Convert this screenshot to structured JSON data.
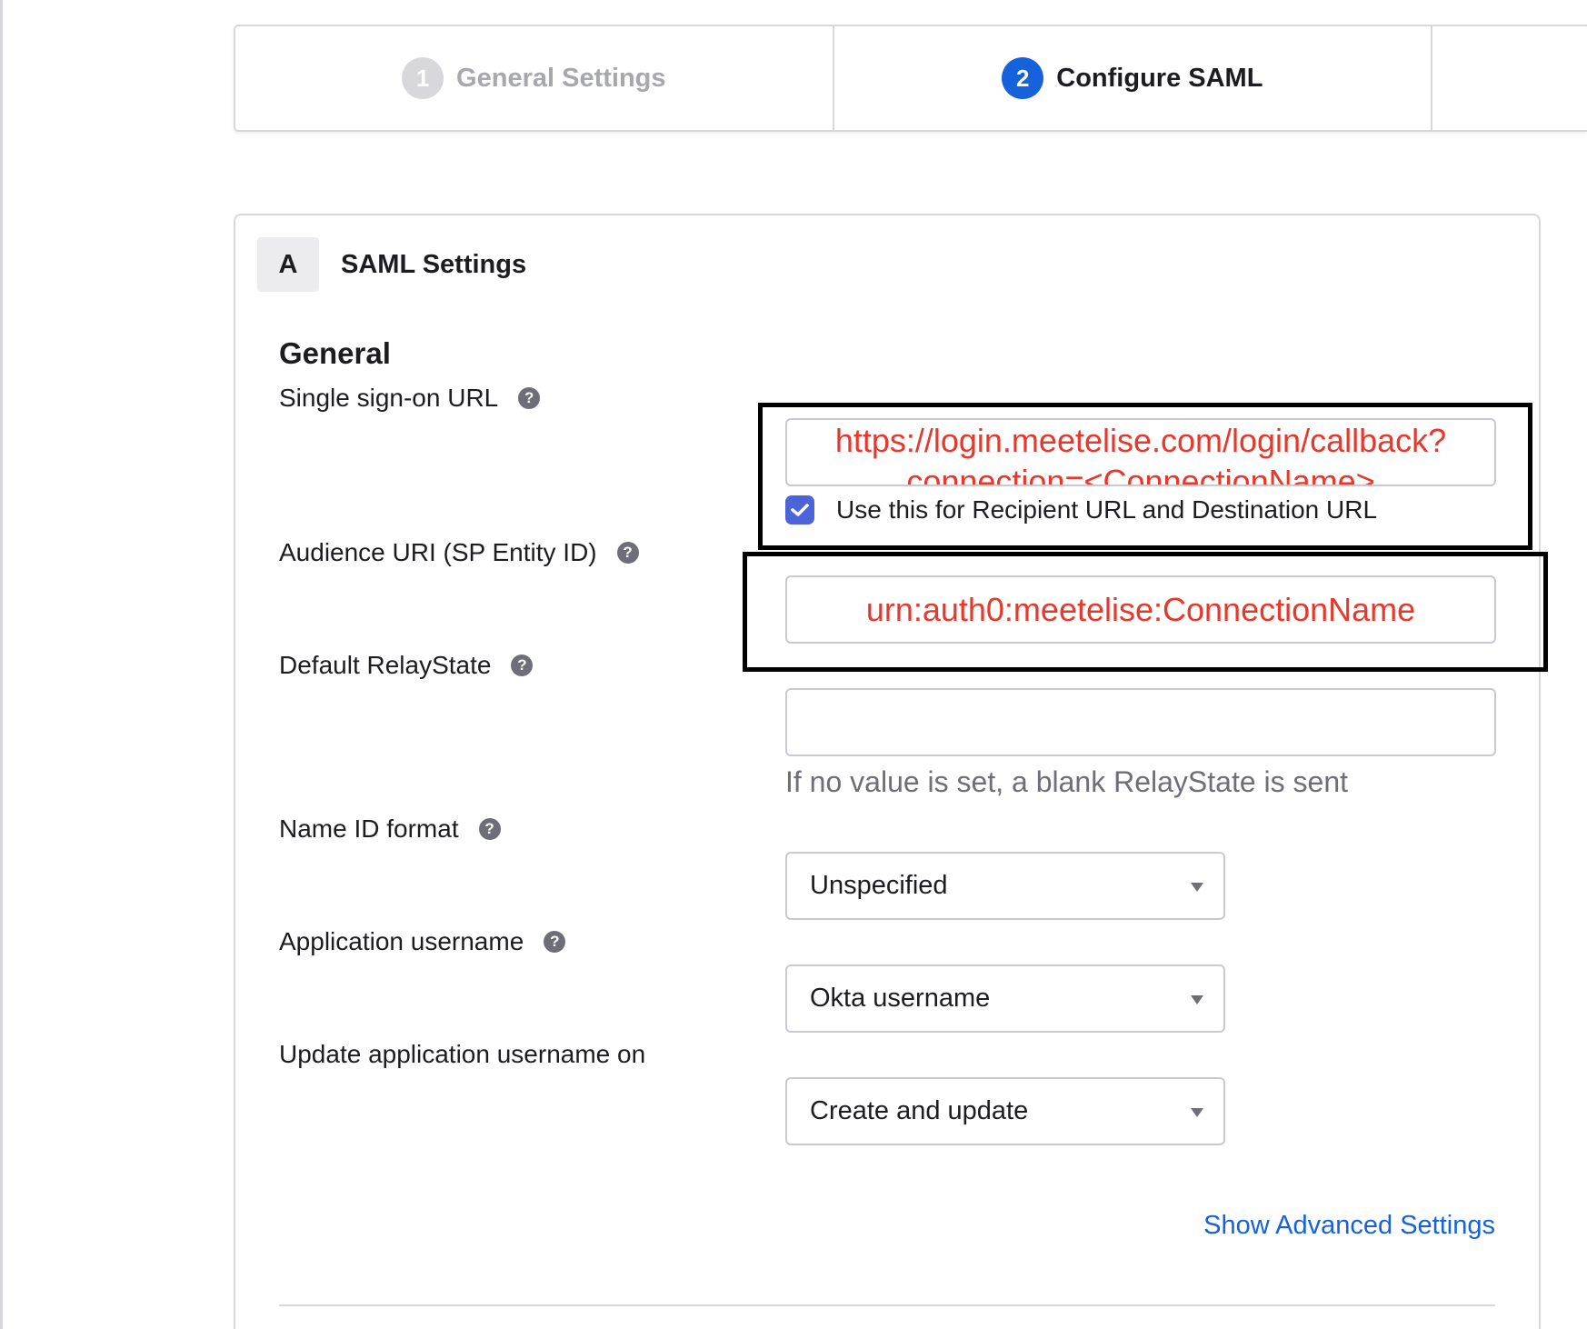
{
  "steps": [
    {
      "number": "1",
      "label": "General Settings",
      "state": "inactive"
    },
    {
      "number": "2",
      "label": "Configure SAML",
      "state": "active"
    }
  ],
  "card": {
    "badge": "A",
    "title": "SAML Settings",
    "section": "General"
  },
  "fields": {
    "sso_url": {
      "label": "Single sign-on URL",
      "value_line1": "https://login.meetelise.com/login/callback?",
      "value_line2": "connection=<ConnectionName>",
      "checkbox_label": "Use this for Recipient URL and Destination URL",
      "checked": true
    },
    "audience_uri": {
      "label": "Audience URI (SP Entity ID)",
      "value": "urn:auth0:meetelise:ConnectionName"
    },
    "relay_state": {
      "label": "Default RelayState",
      "value": "",
      "hint": "If no value is set, a blank RelayState is sent"
    },
    "name_id_format": {
      "label": "Name ID format",
      "selected": "Unspecified"
    },
    "app_username": {
      "label": "Application username",
      "selected": "Okta username"
    },
    "update_username": {
      "label": "Update application username on",
      "selected": "Create and update"
    }
  },
  "links": {
    "advanced": "Show Advanced Settings"
  },
  "icons": {
    "help": "?"
  },
  "colors": {
    "accent": "#1662dd",
    "annotation_text": "#e8372b",
    "checkbox": "#4c64d9"
  }
}
